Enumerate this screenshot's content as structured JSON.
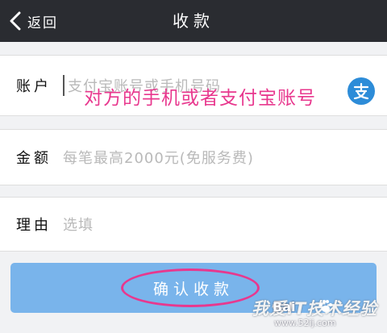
{
  "nav": {
    "back_label": "返回",
    "title": "收款"
  },
  "form": {
    "account": {
      "label": "账户",
      "placeholder": "支付宝账号或手机号码"
    },
    "amount": {
      "label": "金额",
      "placeholder": "每笔最高2000元(免服务费)"
    },
    "reason": {
      "label": "理由",
      "placeholder": "选填"
    }
  },
  "annotation": {
    "caption": "对方的手机或者支付宝账号",
    "color": "#e8388e"
  },
  "confirm_button": {
    "label": "确认收款",
    "color": "#79b4eb"
  },
  "watermark": {
    "baidu": "Bai",
    "text": "我爱IT技术经验",
    "url": "www.52ij.com"
  },
  "icons": {
    "back": "chevron-left-icon",
    "contacts": "alipay-icon"
  }
}
